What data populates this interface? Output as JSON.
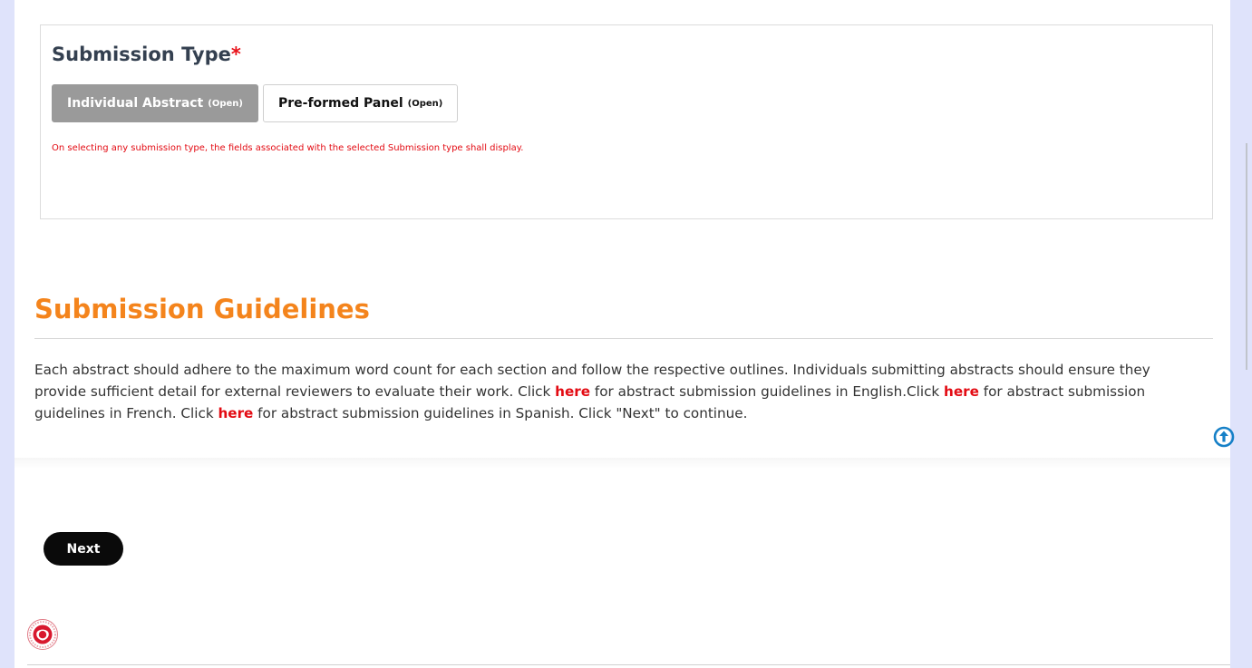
{
  "submission_type": {
    "title": "Submission Type",
    "required_marker": "*",
    "options": [
      {
        "label": "Individual Abstract",
        "status": "(Open)",
        "selected": true
      },
      {
        "label": "Pre-formed Panel",
        "status": "(Open)",
        "selected": false
      }
    ],
    "note": "On selecting any submission type, the fields associated with the selected Submission type shall display."
  },
  "guidelines": {
    "title": "Submission Guidelines",
    "text_1": "Each abstract should adhere to the maximum word count for each section and follow the respective outlines. Individuals submitting abstracts should ensure they provide sufficient detail for external reviewers to evaluate their work. Click ",
    "link_1": "here",
    "text_2": " for abstract submission guidelines in English.Click ",
    "link_2": "here",
    "text_3": " for abstract submission guidelines in French. Click ",
    "link_3": "here",
    "text_4": " for abstract submission guidelines in Spanish. Click \"Next\" to continue."
  },
  "actions": {
    "next_label": "Next"
  },
  "icons": {
    "scroll_top": "arrow-circle-up-icon",
    "logo": "organization-logo"
  },
  "colors": {
    "page_background": "#dfe3fb",
    "heading_dark": "#344050",
    "required_red": "#e8121a",
    "guidelines_orange": "#f4841c",
    "link_red": "#e30b13",
    "selected_button": "#9a9a9a",
    "next_button": "#0a0a0a",
    "scroll_icon_blue": "#1680c7"
  }
}
